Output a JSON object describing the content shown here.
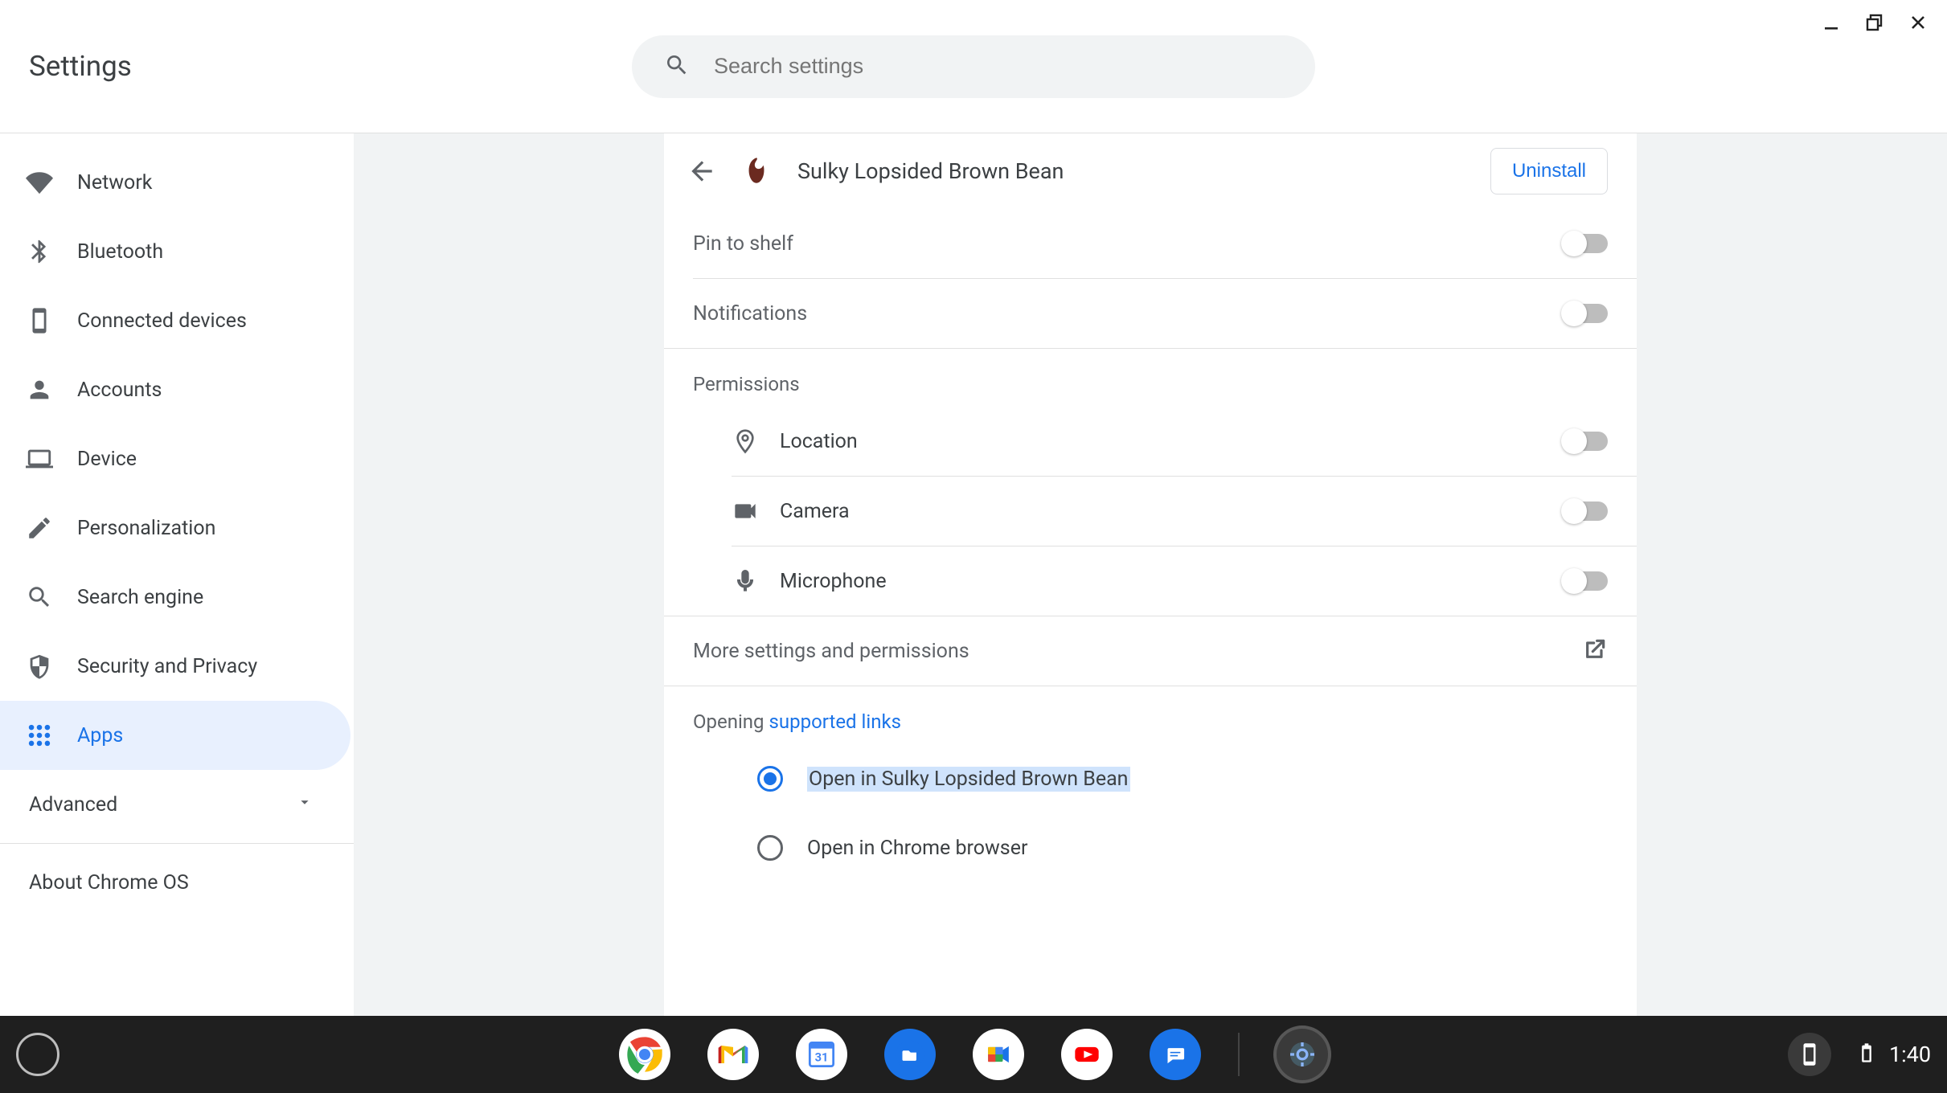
{
  "window": {
    "title": "Settings"
  },
  "search": {
    "placeholder": "Search settings"
  },
  "sidebar": {
    "items": [
      {
        "id": "network",
        "label": "Network"
      },
      {
        "id": "bluetooth",
        "label": "Bluetooth"
      },
      {
        "id": "connected-devices",
        "label": "Connected devices"
      },
      {
        "id": "accounts",
        "label": "Accounts"
      },
      {
        "id": "device",
        "label": "Device"
      },
      {
        "id": "personalization",
        "label": "Personalization"
      },
      {
        "id": "search-engine",
        "label": "Search engine"
      },
      {
        "id": "security-privacy",
        "label": "Security and Privacy"
      },
      {
        "id": "apps",
        "label": "Apps",
        "selected": true
      }
    ],
    "advanced_label": "Advanced",
    "about_label": "About Chrome OS"
  },
  "detail": {
    "app_name": "Sulky Lopsided Brown Bean",
    "uninstall_label": "Uninstall",
    "pin_label": "Pin to shelf",
    "notifications_label": "Notifications",
    "permissions_header": "Permissions",
    "permissions": {
      "location": "Location",
      "camera": "Camera",
      "microphone": "Microphone"
    },
    "more_label": "More settings and permissions",
    "opening_prefix": "Opening ",
    "opening_link": "supported links",
    "radio_open_app": "Open in Sulky Lopsided Brown Bean",
    "radio_open_chrome": "Open in Chrome browser"
  },
  "shelf": {
    "time": "1:40"
  }
}
